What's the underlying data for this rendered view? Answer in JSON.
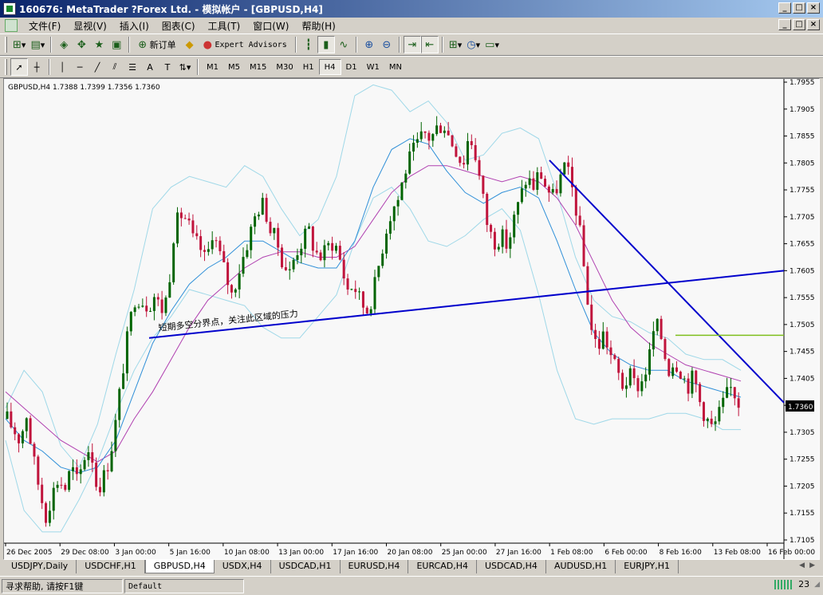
{
  "window": {
    "title": "160676: MetaTrader ?Forex Ltd. - 模拟帐户 - [GBPUSD,H4]",
    "controls": [
      "_",
      "□",
      "×"
    ]
  },
  "menu": {
    "items": [
      "文件(F)",
      "显视(V)",
      "插入(I)",
      "图表(C)",
      "工具(T)",
      "窗口(W)",
      "帮助(H)"
    ]
  },
  "toolbar": {
    "new_order_label": "新订单",
    "expert_advisors_label": "Expert Advisors"
  },
  "timeframes": [
    "M1",
    "M5",
    "M15",
    "M30",
    "H1",
    "H4",
    "D1",
    "W1",
    "MN"
  ],
  "active_timeframe": "H4",
  "chart": {
    "header": "GBPUSD,H4  1.7388 1.7399 1.7356 1.7360",
    "annotation": "短期多空分界点，关注此区域的压力",
    "current_price_label": "1.7360",
    "colors": {
      "bull": "#006400",
      "bear": "#c0143c",
      "bollinger": "#9fd8e8",
      "ma_fast": "#2f8fd8",
      "ma_slow": "#b040b0",
      "trendline": "#0000cc",
      "hline": "#7fbf1f"
    }
  },
  "chart_data": {
    "type": "candlestick",
    "symbol": "GBPUSD",
    "timeframe": "H4",
    "ohlc_header": [
      1.7388,
      1.7399,
      1.7356,
      1.736
    ],
    "ylim": [
      1.7105,
      1.7955
    ],
    "y_ticks": [
      "1.7955",
      "1.7905",
      "1.7855",
      "1.7805",
      "1.7755",
      "1.7705",
      "1.7655",
      "1.7605",
      "1.7555",
      "1.7505",
      "1.7455",
      "1.7405",
      "1.7355",
      "1.7305",
      "1.7255",
      "1.7205",
      "1.7155",
      "1.7105"
    ],
    "x_ticks": [
      "26 Dec 2005",
      "29 Dec 08:00",
      "3 Jan 00:00",
      "5 Jan 16:00",
      "10 Jan 08:00",
      "13 Jan 00:00",
      "17 Jan 16:00",
      "20 Jan 08:00",
      "25 Jan 00:00",
      "27 Jan 16:00",
      "1 Feb 08:00",
      "6 Feb 00:00",
      "8 Feb 16:00",
      "13 Feb 08:00",
      "16 Feb 00:00"
    ],
    "close_path": [
      1.733,
      1.731,
      1.729,
      1.734,
      1.726,
      1.72,
      1.715,
      1.719,
      1.722,
      1.72,
      1.724,
      1.721,
      1.726,
      1.728,
      1.72,
      1.722,
      1.726,
      1.733,
      1.742,
      1.75,
      1.756,
      1.755,
      1.754,
      1.756,
      1.753,
      1.756,
      1.768,
      1.771,
      1.77,
      1.766,
      1.765,
      1.762,
      1.768,
      1.764,
      1.76,
      1.756,
      1.76,
      1.764,
      1.768,
      1.772,
      1.773,
      1.768,
      1.766,
      1.762,
      1.76,
      1.764,
      1.766,
      1.768,
      1.764,
      1.763,
      1.765,
      1.766,
      1.762,
      1.757,
      1.758,
      1.755,
      1.753,
      1.756,
      1.762,
      1.768,
      1.772,
      1.774,
      1.779,
      1.782,
      1.784,
      1.786,
      1.785,
      1.787,
      1.788,
      1.785,
      1.783,
      1.78,
      1.786,
      1.782,
      1.775,
      1.768,
      1.766,
      1.767,
      1.765,
      1.77,
      1.774,
      1.778,
      1.776,
      1.779,
      1.776,
      1.774,
      1.777,
      1.78,
      1.776,
      1.77,
      1.76,
      1.75,
      1.746,
      1.749,
      1.745,
      1.742,
      1.739,
      1.741,
      1.739,
      1.74,
      1.744,
      1.751,
      1.748,
      1.742,
      1.744,
      1.742,
      1.739,
      1.741,
      1.736,
      1.733,
      1.731,
      1.734,
      1.737,
      1.739,
      1.736
    ],
    "bollinger_upper": [
      1.735,
      1.742,
      1.738,
      1.728,
      1.724,
      1.732,
      1.745,
      1.757,
      1.772,
      1.776,
      1.778,
      1.777,
      1.776,
      1.78,
      1.778,
      1.772,
      1.767,
      1.77,
      1.778,
      1.793,
      1.795,
      1.794,
      1.79,
      1.792,
      1.788,
      1.781,
      1.782,
      1.786,
      1.787,
      1.785,
      1.775,
      1.763,
      1.755,
      1.752,
      1.751,
      1.749,
      1.748,
      1.745,
      1.744,
      1.744,
      1.742
    ],
    "bollinger_lower": [
      1.729,
      1.716,
      1.712,
      1.712,
      1.718,
      1.725,
      1.734,
      1.742,
      1.748,
      1.752,
      1.757,
      1.756,
      1.755,
      1.754,
      1.75,
      1.748,
      1.748,
      1.752,
      1.756,
      1.766,
      1.774,
      1.776,
      1.772,
      1.766,
      1.765,
      1.767,
      1.77,
      1.772,
      1.768,
      1.756,
      1.742,
      1.733,
      1.732,
      1.733,
      1.733,
      1.733,
      1.734,
      1.734,
      1.733,
      1.731,
      1.731
    ],
    "ma_fast": [
      1.733,
      1.729,
      1.727,
      1.724,
      1.723,
      1.724,
      1.729,
      1.738,
      1.747,
      1.753,
      1.758,
      1.761,
      1.763,
      1.766,
      1.766,
      1.764,
      1.762,
      1.761,
      1.761,
      1.766,
      1.776,
      1.783,
      1.785,
      1.784,
      1.779,
      1.775,
      1.773,
      1.775,
      1.776,
      1.774,
      1.766,
      1.757,
      1.749,
      1.745,
      1.743,
      1.742,
      1.742,
      1.74,
      1.739,
      1.738,
      1.737
    ],
    "ma_slow": [
      1.738,
      1.735,
      1.732,
      1.729,
      1.727,
      1.725,
      1.727,
      1.733,
      1.738,
      1.744,
      1.75,
      1.755,
      1.758,
      1.761,
      1.763,
      1.764,
      1.764,
      1.763,
      1.763,
      1.765,
      1.77,
      1.775,
      1.778,
      1.78,
      1.78,
      1.779,
      1.778,
      1.777,
      1.778,
      1.777,
      1.774,
      1.769,
      1.762,
      1.755,
      1.75,
      1.747,
      1.745,
      1.743,
      1.742,
      1.741,
      1.74
    ],
    "support_line": {
      "from": [
        "3 Jan",
        1.748
      ],
      "to": [
        "16 Feb",
        1.7605
      ]
    },
    "resistance_line": {
      "from": [
        "1 Feb",
        1.781
      ],
      "to": [
        "17 Feb",
        1.736
      ]
    },
    "horizontal_line": 1.7485
  },
  "tabs": [
    "USDJPY,Daily",
    "USDCHF,H1",
    "GBPUSD,H4",
    "USDX,H4",
    "USDCAD,H1",
    "EURUSD,H4",
    "EURCAD,H4",
    "USDCAD,H4",
    "AUDUSD,H1",
    "EURJPY,H1"
  ],
  "active_tab": "GBPUSD,H4",
  "status": {
    "help": "寻求帮助, 请按F1键",
    "profile": "Default",
    "right_value": "23"
  }
}
